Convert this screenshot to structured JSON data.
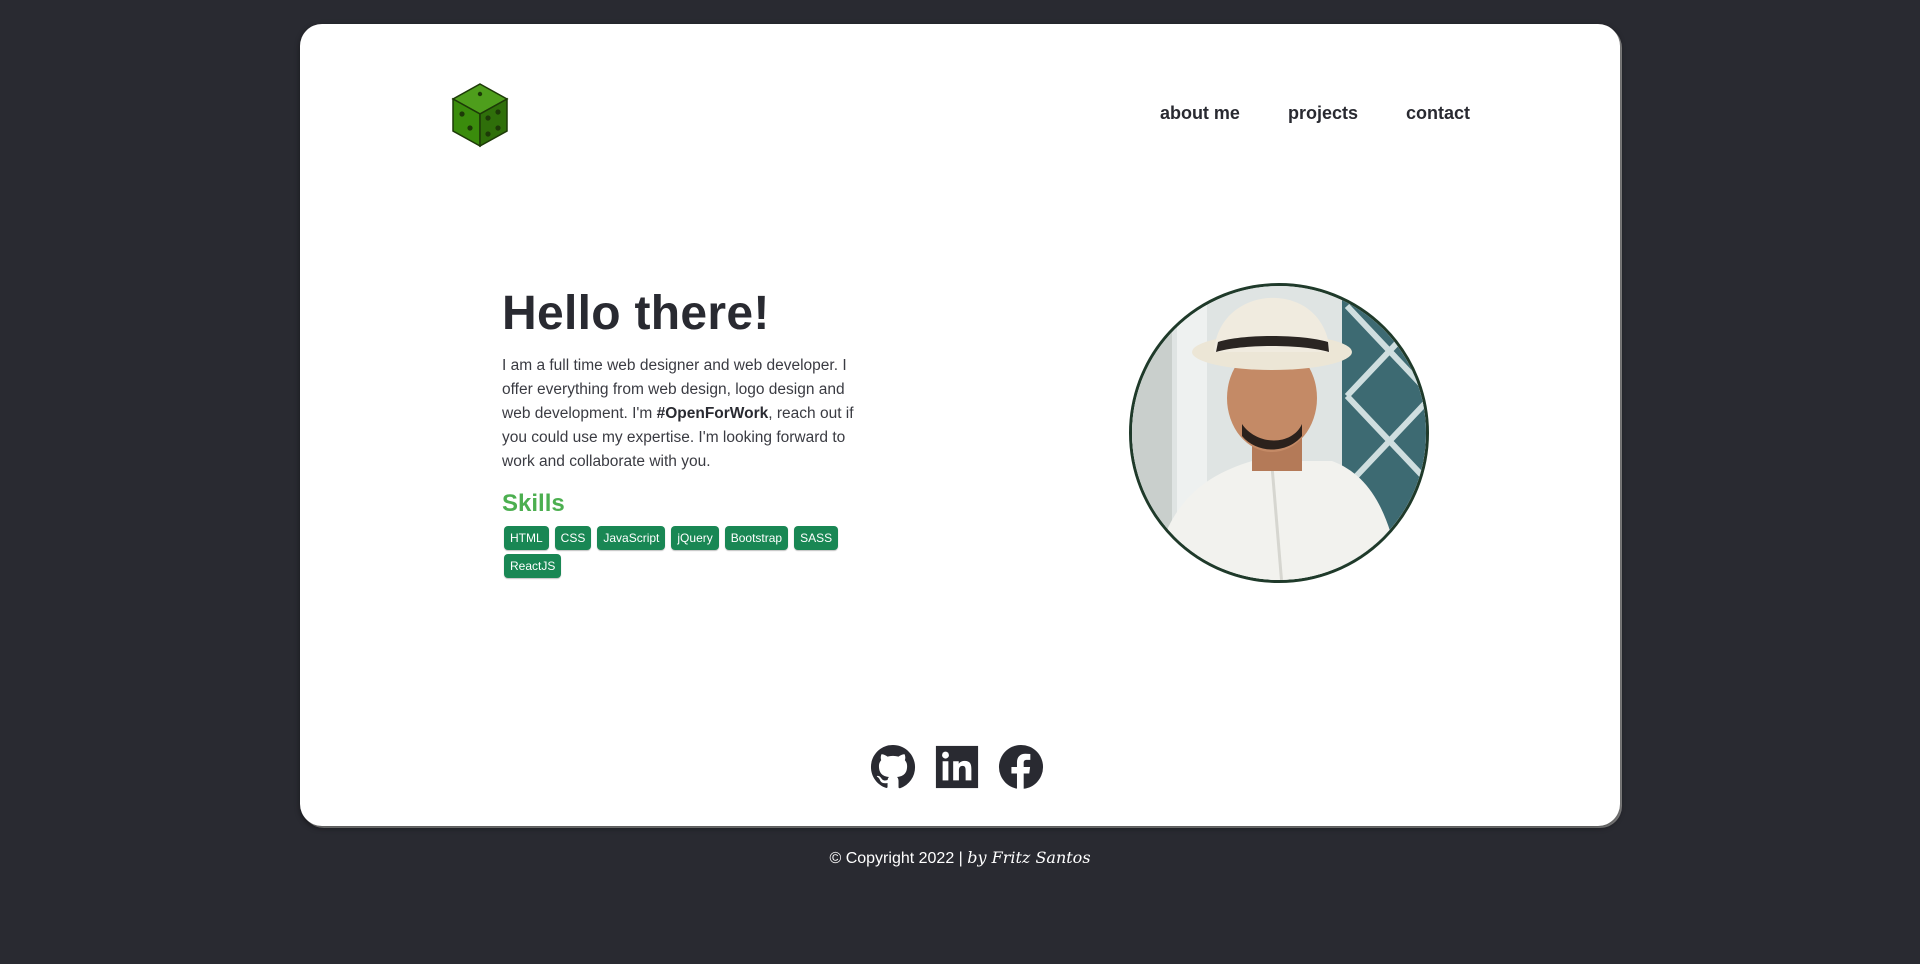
{
  "nav": {
    "items": [
      {
        "label": "about me"
      },
      {
        "label": "projects"
      },
      {
        "label": "contact"
      }
    ]
  },
  "logo": {
    "icon": "dice-cube-logo",
    "color": "#3a8c0c"
  },
  "hero": {
    "title": "Hello there!",
    "intro_before": "I am a full time web designer and web developer. I offer everything from web design, logo design and web development. I'm ",
    "intro_bold": "#OpenForWork",
    "intro_after": ", reach out if you could use my expertise. I'm looking forward to work and collaborate with you.",
    "skills_title": "Skills",
    "skills": [
      "HTML",
      "CSS",
      "JavaScript",
      "jQuery",
      "Bootstrap",
      "SASS",
      "ReactJS"
    ]
  },
  "portrait": {
    "icon": "profile-photo"
  },
  "social": [
    {
      "icon": "github-icon"
    },
    {
      "icon": "linkedin-icon"
    },
    {
      "icon": "facebook-icon"
    }
  ],
  "footer": {
    "copyright": "© Copyright 2022 | ",
    "author": "by Fritz Santos"
  },
  "colors": {
    "background": "#292a31",
    "card": "#ffffff",
    "accent_green": "#4caf50",
    "badge": "#198754"
  }
}
